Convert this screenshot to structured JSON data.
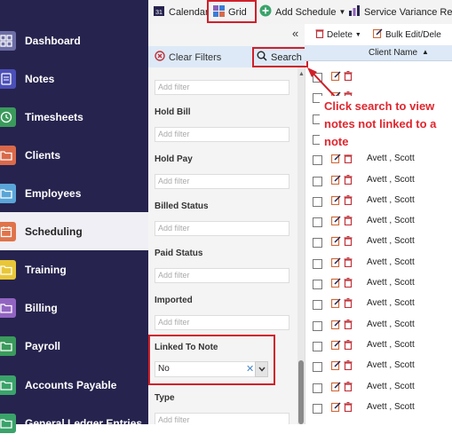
{
  "sidebar": {
    "items": [
      {
        "label": "Dashboard",
        "icon": "dashboard-icon",
        "color": "#6d6ea5"
      },
      {
        "label": "Notes",
        "icon": "notes-icon",
        "color": "#4b4fb8"
      },
      {
        "label": "Timesheets",
        "icon": "clock-icon",
        "color": "#3a9a5c"
      },
      {
        "label": "Clients",
        "icon": "folder-icon",
        "color": "#d9694a"
      },
      {
        "label": "Employees",
        "icon": "folder-icon",
        "color": "#5aa5d8"
      },
      {
        "label": "Scheduling",
        "icon": "calendar-icon",
        "color": "#e0734a"
      },
      {
        "label": "Training",
        "icon": "folder-icon",
        "color": "#e8c638"
      },
      {
        "label": "Billing",
        "icon": "folder-icon",
        "color": "#9264c2"
      },
      {
        "label": "Payroll",
        "icon": "payroll-icon",
        "color": "#3a9a5c"
      },
      {
        "label": "Accounts Payable",
        "icon": "folder-icon",
        "color": "#3aa36a"
      },
      {
        "label": "General Ledger Entries",
        "icon": "folder-icon",
        "color": "#3aa36a"
      }
    ],
    "active": "Scheduling"
  },
  "toolbar": {
    "calendar": "Calendar",
    "grid": "Grid",
    "add_schedule": "Add Schedule",
    "service_variance": "Service Variance Re"
  },
  "grid_toolbar": {
    "collapse": "«",
    "delete": "Delete",
    "bulk_edit": "Bulk Edit/Dele"
  },
  "filter_panel": {
    "clear_filters": "Clear Filters",
    "search": "Search",
    "filters": [
      {
        "label": "",
        "placeholder": "Add filter"
      },
      {
        "label": "Hold Bill",
        "placeholder": "Add filter"
      },
      {
        "label": "Hold Pay",
        "placeholder": "Add filter"
      },
      {
        "label": "Billed Status",
        "placeholder": "Add filter"
      },
      {
        "label": "Paid Status",
        "placeholder": "Add filter"
      },
      {
        "label": "Imported",
        "placeholder": "Add filter"
      }
    ],
    "linked_to_note": {
      "label": "Linked To Note",
      "value": "No"
    },
    "type": {
      "label": "Type",
      "placeholder": "Add filter"
    }
  },
  "grid": {
    "column_header": "Client Name",
    "rows": [
      "",
      "",
      "",
      "",
      "Avett , Scott",
      "Avett , Scott",
      "Avett , Scott",
      "Avett , Scott",
      "Avett , Scott",
      "Avett , Scott",
      "Avett , Scott",
      "Avett , Scott",
      "Avett , Scott",
      "Avett , Scott",
      "Avett , Scott",
      "Avett , Scott",
      "Avett , Scott"
    ]
  },
  "annotation": {
    "text": "Click search to view notes not linked to a note"
  },
  "colors": {
    "sidebar_bg": "#26234e",
    "highlight": "#d0202a",
    "annotation_text": "#e0262e"
  }
}
